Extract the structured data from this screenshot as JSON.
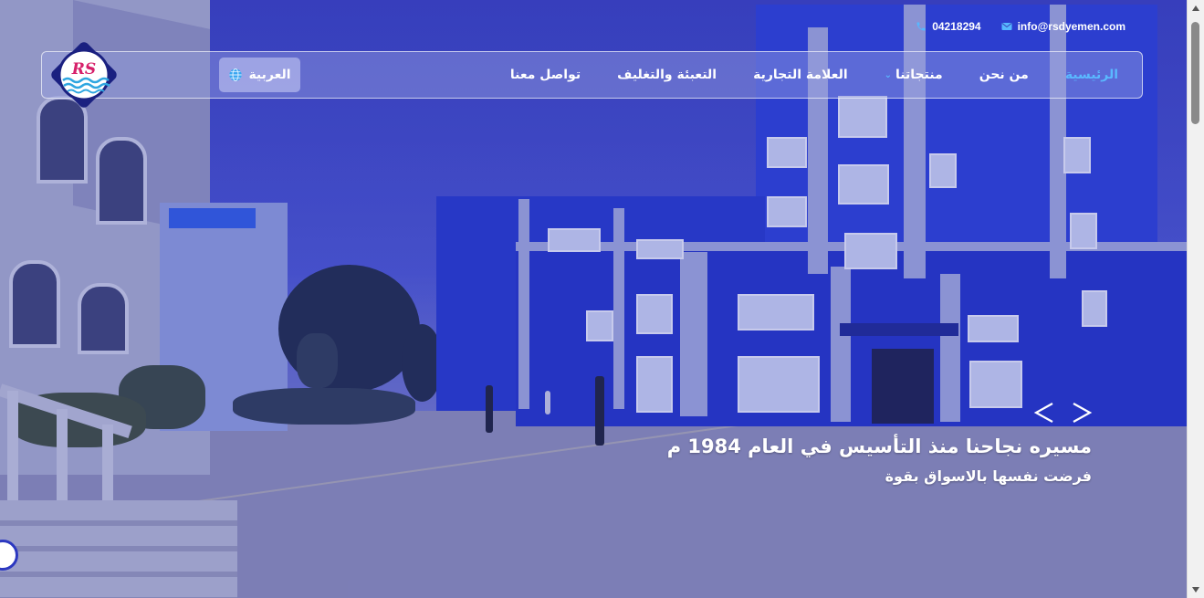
{
  "contact": {
    "phone": "04218294",
    "email": "info@rsdyemen.com",
    "phone_icon": "phone-icon",
    "email_icon": "envelope-icon"
  },
  "logo": {
    "text": "RS"
  },
  "language": {
    "label": "العربية",
    "icon": "globe-icon"
  },
  "nav": {
    "items": [
      {
        "label": "الرئيسية",
        "active": true
      },
      {
        "label": "من نحن"
      },
      {
        "label": "منتجاتنا",
        "has_dropdown": true
      },
      {
        "label": "العلامة التجارية"
      },
      {
        "label": "التعبئة والتغليف"
      },
      {
        "label": "تواصل معنا"
      }
    ]
  },
  "slider": {
    "title": "مسيره نجاحنا منذ التأسيس في العام 1984 م",
    "subtitle": "فرضت نفسها بالاسواق بقوة",
    "prev_icon": "chevron-left-icon",
    "next_icon": "chevron-right-icon"
  },
  "colors": {
    "accent": "#5ab8ff",
    "overlay": "#3a44b8"
  }
}
